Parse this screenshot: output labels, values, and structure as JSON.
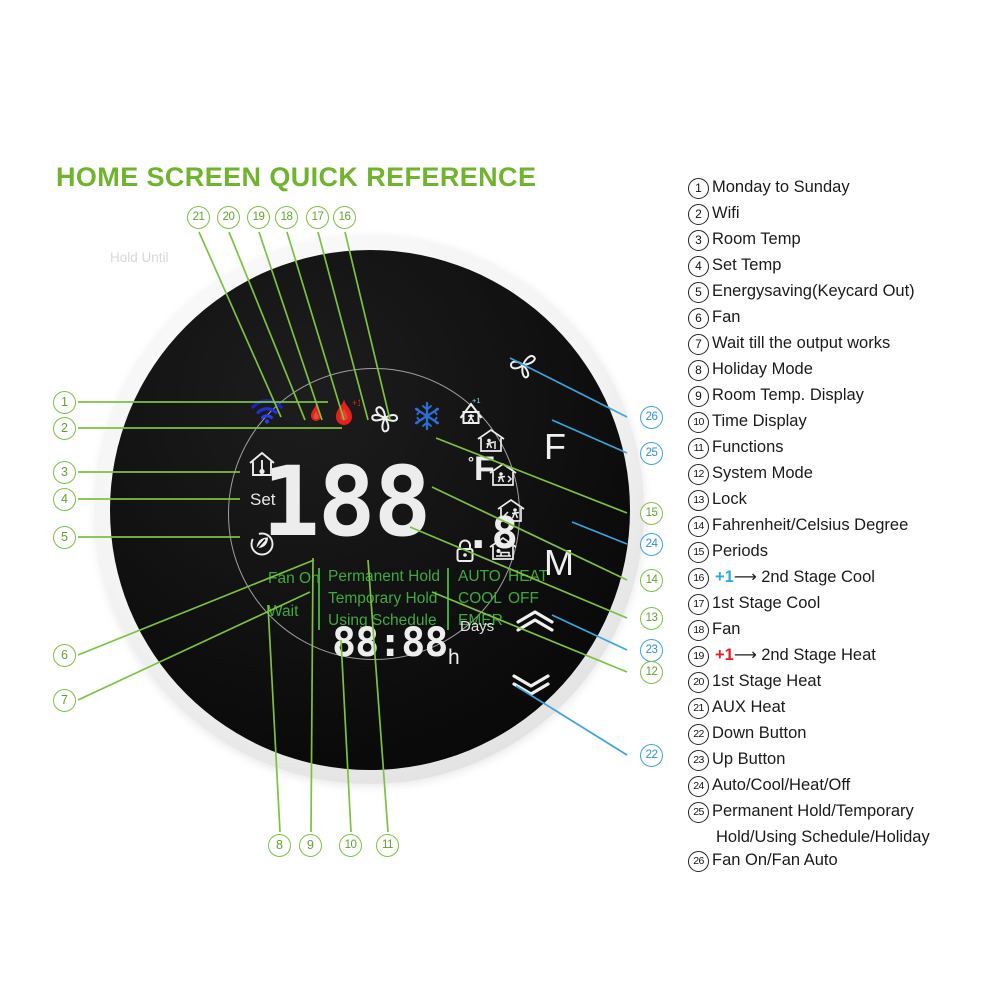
{
  "page": {
    "title": "HOME SCREEN QUICK REFERENCE",
    "title_color": "#6fb42c"
  },
  "device": {
    "type": "round-thermostat",
    "bezel_color": "#e8e8e8",
    "face_color": "#0b0b0b",
    "lcd": {
      "temperature": "188",
      "temperature_decimal": ".8",
      "degree_unit": "°F",
      "set_label": "Set",
      "clock": "88:88",
      "clock_unit": "h",
      "days_label": "Days",
      "hold_until_label": "Hold Until",
      "green_color": "#3fa93f",
      "status_left": [
        "Fan On",
        "Wait"
      ],
      "hold_modes": [
        "Permanent Hold",
        "Temporary Hold",
        "Using Schedule"
      ],
      "system_modes_col1": [
        "AUTO",
        "COOL",
        "EMER"
      ],
      "system_modes_col2": [
        "HEAT",
        "OFF"
      ],
      "icons": [
        {
          "name": "wifi-icon",
          "label": "Wifi"
        },
        {
          "name": "flame-small-icon",
          "label": "1st Stage Heat"
        },
        {
          "name": "flame-large-icon",
          "label": "2nd Stage Heat"
        },
        {
          "name": "fan-blade-icon",
          "label": "Fan"
        },
        {
          "name": "snowflake-icon",
          "label": "Cool"
        },
        {
          "name": "aux-heat-icon",
          "label": "AUX Heat"
        },
        {
          "name": "house-thermometer-icon",
          "label": "Room Temp"
        },
        {
          "name": "energy-saving-icon",
          "label": "Energysaving"
        },
        {
          "name": "period-wake-icon",
          "label": "Wake"
        },
        {
          "name": "period-leave-icon",
          "label": "Leave"
        },
        {
          "name": "period-return-icon",
          "label": "Return"
        },
        {
          "name": "period-sleep-icon",
          "label": "Sleep"
        },
        {
          "name": "lock-icon",
          "label": "Lock"
        }
      ]
    },
    "buttons": [
      {
        "name": "fan-auto-button",
        "label": "fan-icon"
      },
      {
        "name": "fahrenheit-button",
        "label": "F"
      },
      {
        "name": "mode-button",
        "label": "M"
      },
      {
        "name": "up-button",
        "label": "❯"
      },
      {
        "name": "down-button",
        "label": "❯"
      }
    ]
  },
  "callouts": {
    "green_color": "#7cc142",
    "blue_color": "#3aa5dd",
    "left": [
      {
        "n": "1"
      },
      {
        "n": "2"
      },
      {
        "n": "3"
      },
      {
        "n": "4"
      },
      {
        "n": "5"
      },
      {
        "n": "6"
      },
      {
        "n": "7"
      }
    ],
    "top": [
      {
        "n": "21"
      },
      {
        "n": "20"
      },
      {
        "n": "19"
      },
      {
        "n": "18"
      },
      {
        "n": "17"
      },
      {
        "n": "16"
      }
    ],
    "bottom": [
      {
        "n": "8"
      },
      {
        "n": "9"
      },
      {
        "n": "10"
      },
      {
        "n": "11"
      }
    ],
    "right": [
      {
        "n": "26"
      },
      {
        "n": "25"
      },
      {
        "n": "15"
      },
      {
        "n": "24"
      },
      {
        "n": "14"
      },
      {
        "n": "13"
      },
      {
        "n": "23"
      },
      {
        "n": "12"
      },
      {
        "n": "22"
      }
    ]
  },
  "legend": {
    "items": [
      {
        "n": "1",
        "text": "Monday to Sunday"
      },
      {
        "n": "2",
        "text": "Wifi"
      },
      {
        "n": "3",
        "text": "Room Temp"
      },
      {
        "n": "4",
        "text": "Set Temp"
      },
      {
        "n": "5",
        "text": "Energysaving(Keycard Out)"
      },
      {
        "n": "6",
        "text": "Fan"
      },
      {
        "n": "7",
        "text": "Wait till the output works"
      },
      {
        "n": "8",
        "text": "Holiday Mode"
      },
      {
        "n": "9",
        "text": "Room Temp. Display"
      },
      {
        "n": "10",
        "text": "Time Display"
      },
      {
        "n": "11",
        "text": "Functions"
      },
      {
        "n": "12",
        "text": "System Mode"
      },
      {
        "n": "13",
        "text": "Lock"
      },
      {
        "n": "14",
        "text": "Fahrenheit/Celsius Degree"
      },
      {
        "n": "15",
        "text": "Periods"
      },
      {
        "n": "16",
        "text": "2nd Stage Cool",
        "prefix": "+1",
        "prefix_color": "#29abe2",
        "arrow": "⟶"
      },
      {
        "n": "17",
        "text": "1st Stage Cool"
      },
      {
        "n": "18",
        "text": "Fan"
      },
      {
        "n": "19",
        "text": "2nd Stage Heat",
        "prefix": "+1",
        "prefix_color": "#ed1c24",
        "arrow": "⟶"
      },
      {
        "n": "20",
        "text": "1st Stage Heat"
      },
      {
        "n": "21",
        "text": "AUX Heat"
      },
      {
        "n": "22",
        "text": "Down Button"
      },
      {
        "n": "23",
        "text": "Up Button"
      },
      {
        "n": "24",
        "text": "Auto/Cool/Heat/Off"
      },
      {
        "n": "25",
        "text": "Permanent Hold/Temporary",
        "continuation": "Hold/Using Schedule/Holiday"
      },
      {
        "n": "26",
        "text": "Fan On/Fan Auto"
      }
    ]
  }
}
